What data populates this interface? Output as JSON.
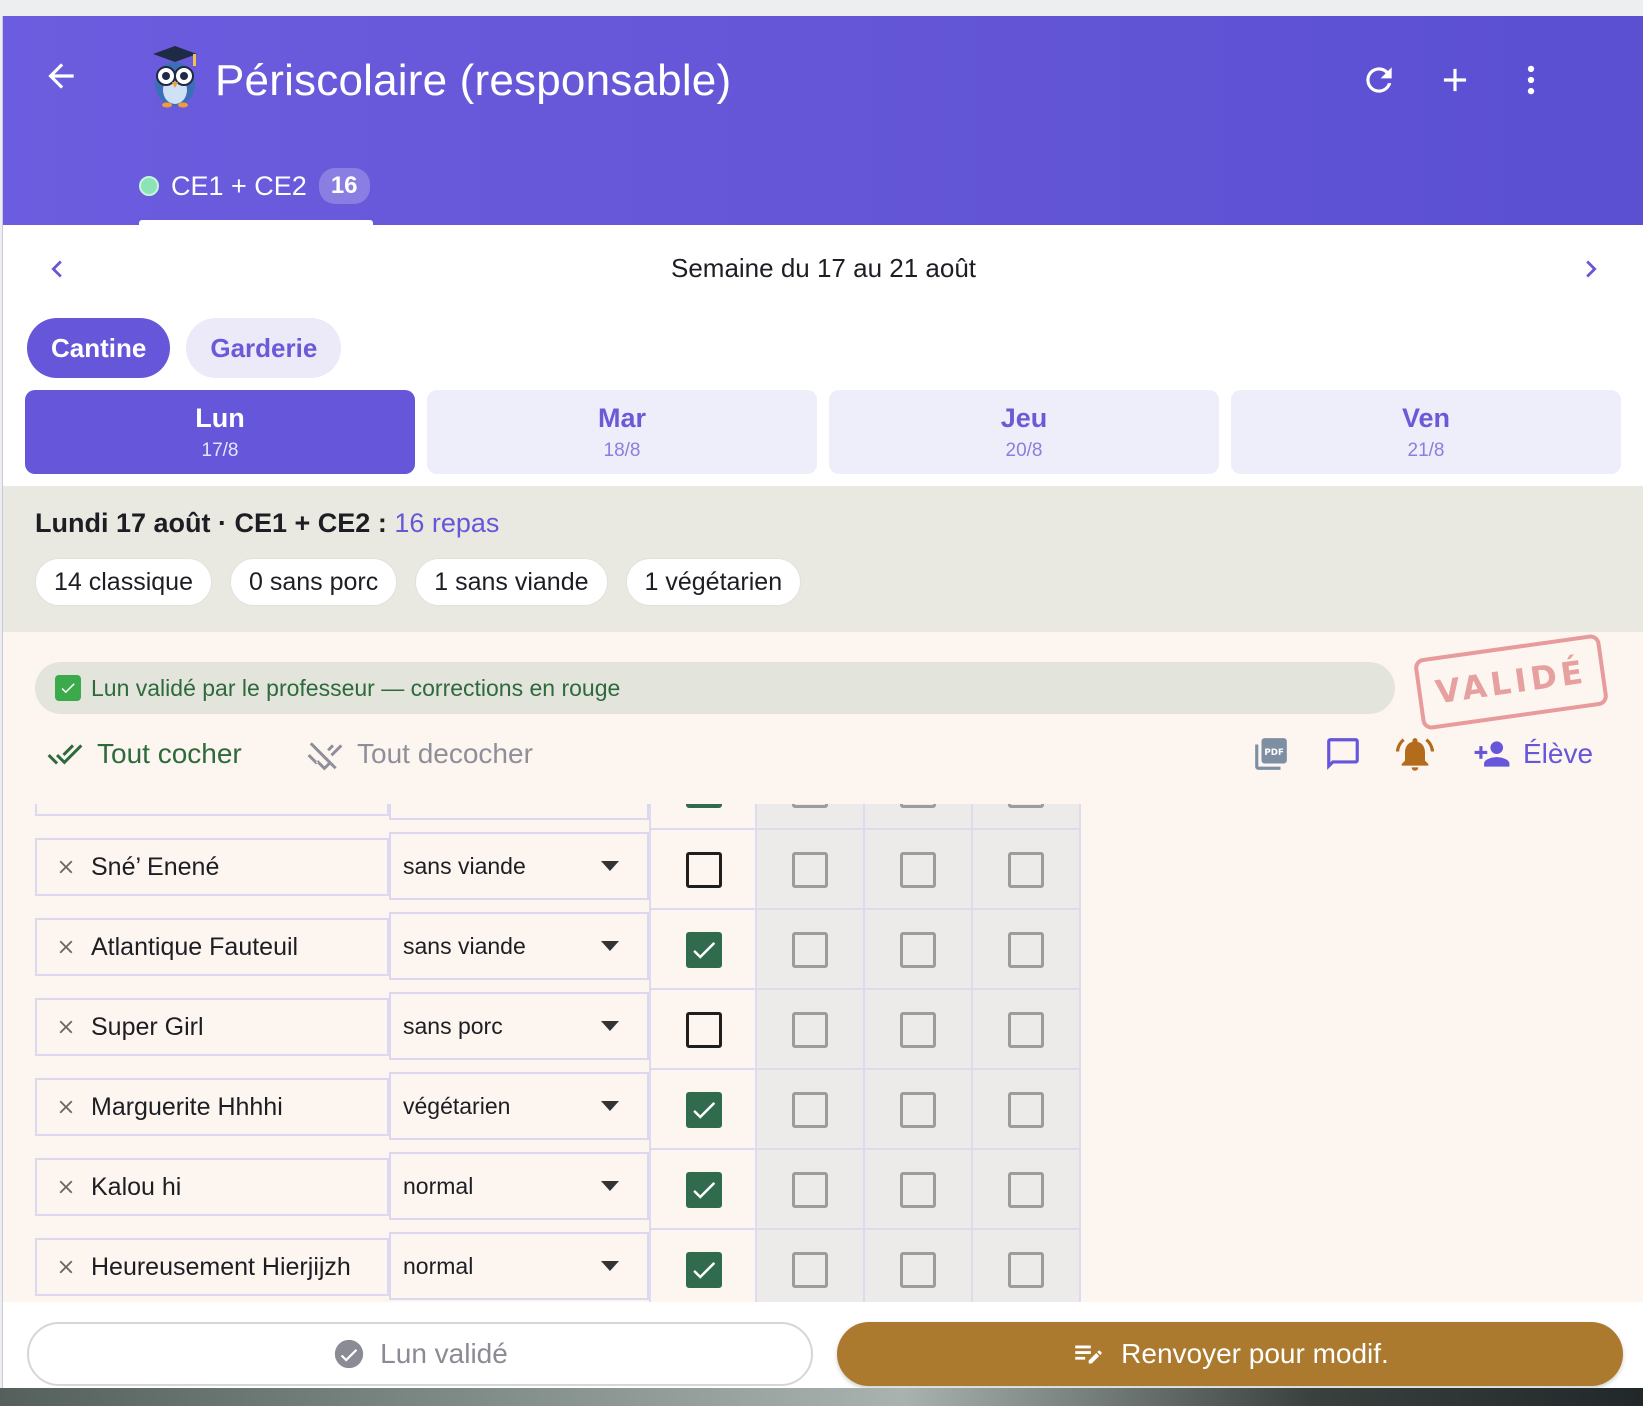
{
  "app": {
    "title": "Périscolaire (responsable)",
    "accent": "#6656d9"
  },
  "class_tab": {
    "label": "CE1 + CE2",
    "count": "16"
  },
  "week": {
    "label": "Semaine du 17 au 21 août"
  },
  "services": [
    {
      "label": "Cantine",
      "active": true
    },
    {
      "label": "Garderie",
      "active": false
    }
  ],
  "days": [
    {
      "name": "Lun",
      "date": "17/8",
      "active": true
    },
    {
      "name": "Mar",
      "date": "18/8",
      "active": false
    },
    {
      "name": "Jeu",
      "date": "20/8",
      "active": false
    },
    {
      "name": "Ven",
      "date": "21/8",
      "active": false
    }
  ],
  "summary": {
    "heading": "Lundi 17 août · CE1 + CE2 : ",
    "highlight": "16 repas",
    "chips": [
      "14 classique",
      "0 sans porc",
      "1 sans viande",
      "1 végétarien"
    ]
  },
  "banner": {
    "text": "Lun validé par le professeur — corrections en rouge"
  },
  "stamp": {
    "text": "VALIDÉ"
  },
  "toolbar": {
    "check_all": "Tout cocher",
    "uncheck_all": "Tout decocher",
    "add_student": "Élève",
    "icons": [
      "pdf-icon",
      "comment-icon",
      "bell-icon"
    ]
  },
  "students": [
    {
      "name": "",
      "diet": "",
      "checks": [
        true,
        false,
        false,
        false
      ],
      "partial": "top"
    },
    {
      "name": "Sné’ Enené",
      "diet": "sans viande",
      "checks": [
        false,
        false,
        false,
        false
      ]
    },
    {
      "name": "Atlantique Fauteuil",
      "diet": "sans viande",
      "checks": [
        true,
        false,
        false,
        false
      ]
    },
    {
      "name": "Super Girl",
      "diet": "sans porc",
      "checks": [
        false,
        false,
        false,
        false
      ]
    },
    {
      "name": "Marguerite Hhhhi",
      "diet": "végétarien",
      "checks": [
        true,
        false,
        false,
        false
      ]
    },
    {
      "name": "Kalou hi",
      "diet": "normal",
      "checks": [
        true,
        false,
        false,
        false
      ]
    },
    {
      "name": "Heureusement Hierjijzh",
      "diet": "normal",
      "checks": [
        true,
        false,
        false,
        false
      ],
      "partial": "bottom"
    }
  ],
  "footer": {
    "validated_label": "Lun validé",
    "resend_label": "Renvoyer pour modif."
  }
}
